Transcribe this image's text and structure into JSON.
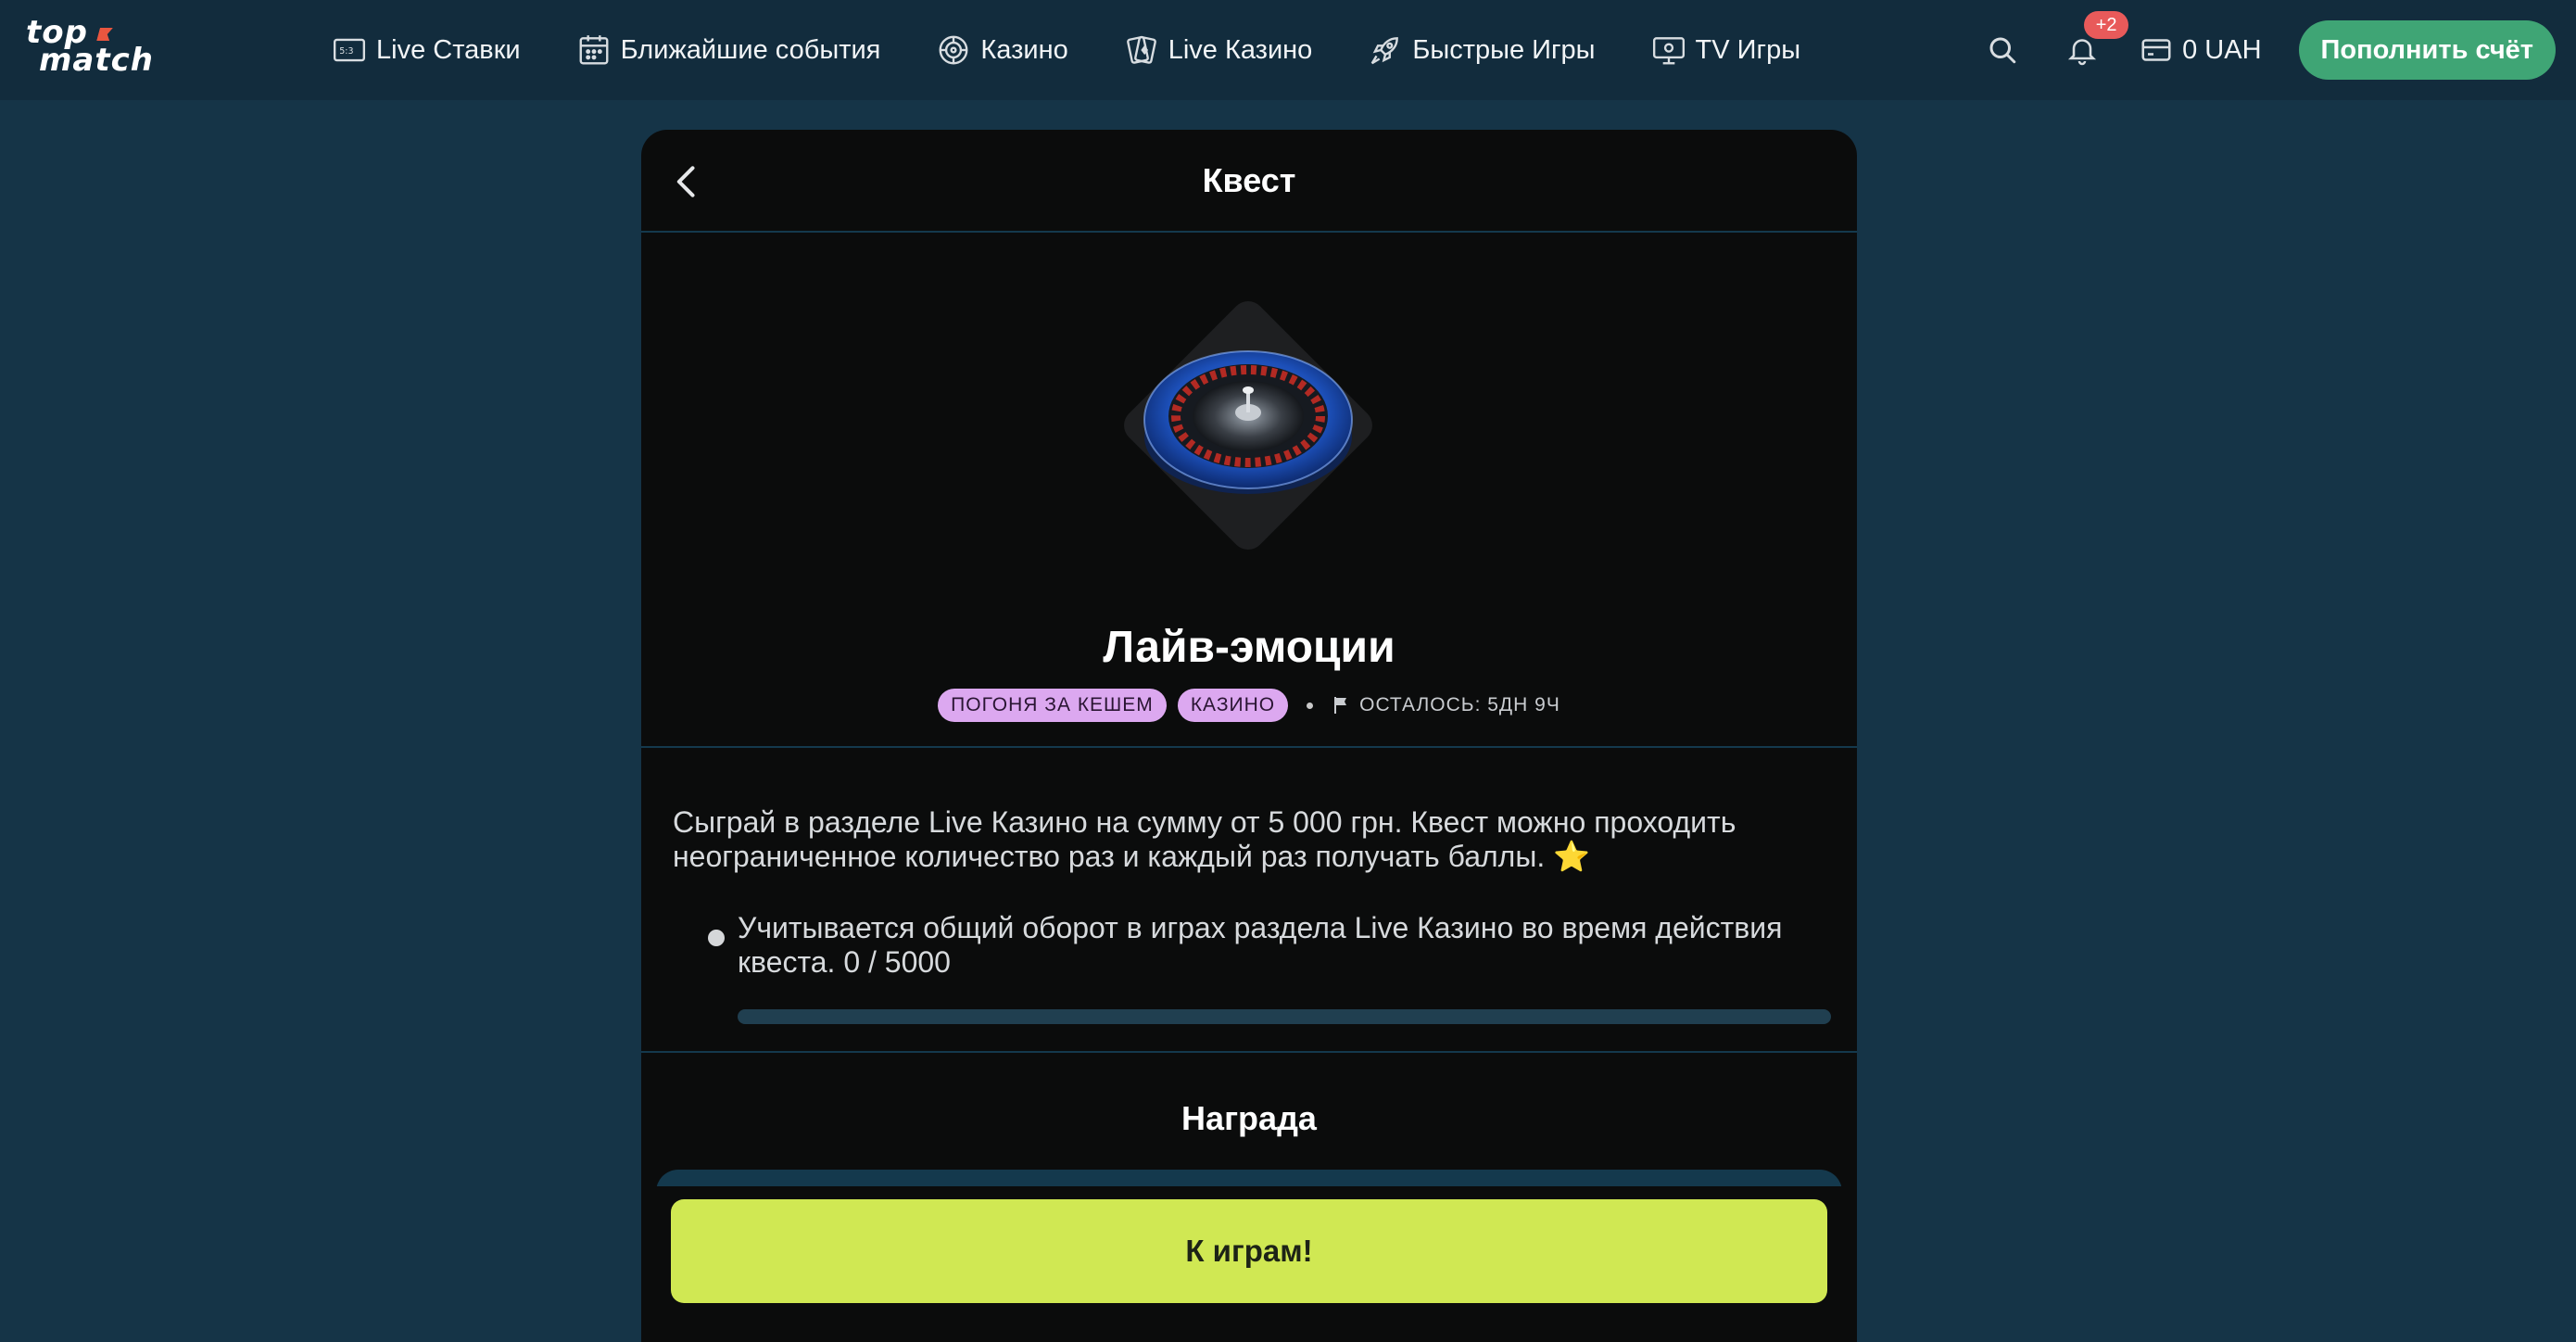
{
  "brand": {
    "logo_line1": "top",
    "logo_line2": "match",
    "accent_color": "#e9563f"
  },
  "nav": {
    "items": [
      {
        "label": "Live Ставки",
        "icon": "scoreboard-icon"
      },
      {
        "label": "Ближайшие события",
        "icon": "calendar-icon"
      },
      {
        "label": "Казино",
        "icon": "roulette-chip-icon"
      },
      {
        "label": "Live Казино",
        "icon": "cards-icon"
      },
      {
        "label": "Быстрые Игры",
        "icon": "rocket-icon"
      },
      {
        "label": "TV Игры",
        "icon": "tv-icon"
      }
    ]
  },
  "header_tools": {
    "notifications_badge": "+2",
    "balance": "0 UAH",
    "deposit_label": "Пополнить счёт",
    "deposit_color": "#3fa575"
  },
  "quest": {
    "header_title": "Квест",
    "name": "Лайв-эмоции",
    "tags": [
      "ПОГОНЯ ЗА КЕШЕМ",
      "КАЗИНО"
    ],
    "tag_color": "#dca8f0",
    "time_left": "ОСТАЛОСЬ: 5ДН 9Ч",
    "description": "Сыграй в разделе Live Казино на сумму от 5 000 грн. Квест можно проходить неограниченное количество раз и каждый раз получать баллы. ⭐",
    "condition_text": "Учитывается общий оборот в играх раздела Live Казино во время действия квеста. 0 / 5000",
    "progress_fraction": 0,
    "reward_title": "Награда",
    "play_label": "К играм!",
    "play_color": "#d0e853"
  }
}
